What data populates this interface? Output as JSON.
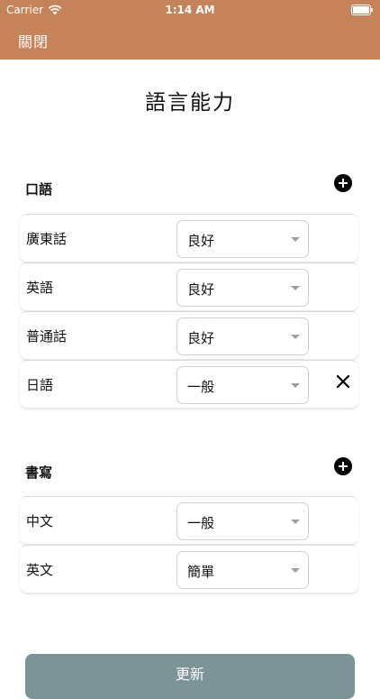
{
  "status_bar": {
    "carrier": "Carrier",
    "time": "1:14 AM"
  },
  "nav": {
    "close_label": "關閉"
  },
  "page": {
    "title": "語言能力"
  },
  "spoken": {
    "header": "口語",
    "rows": [
      {
        "language": "廣東話",
        "level": "良好"
      },
      {
        "language": "英語",
        "level": "良好"
      },
      {
        "language": "普通話",
        "level": "良好"
      },
      {
        "language": "日語",
        "level": "一般"
      }
    ]
  },
  "written": {
    "header": "書寫",
    "rows": [
      {
        "language": "中文",
        "level": "一般"
      },
      {
        "language": "英文",
        "level": "簡單"
      }
    ]
  },
  "actions": {
    "update_label": "更新"
  },
  "colors": {
    "accent": "#c68258",
    "button": "#7c9397"
  },
  "icons": [
    "wifi-icon",
    "battery-icon",
    "add-icon",
    "chevron-down-icon",
    "remove-icon"
  ]
}
